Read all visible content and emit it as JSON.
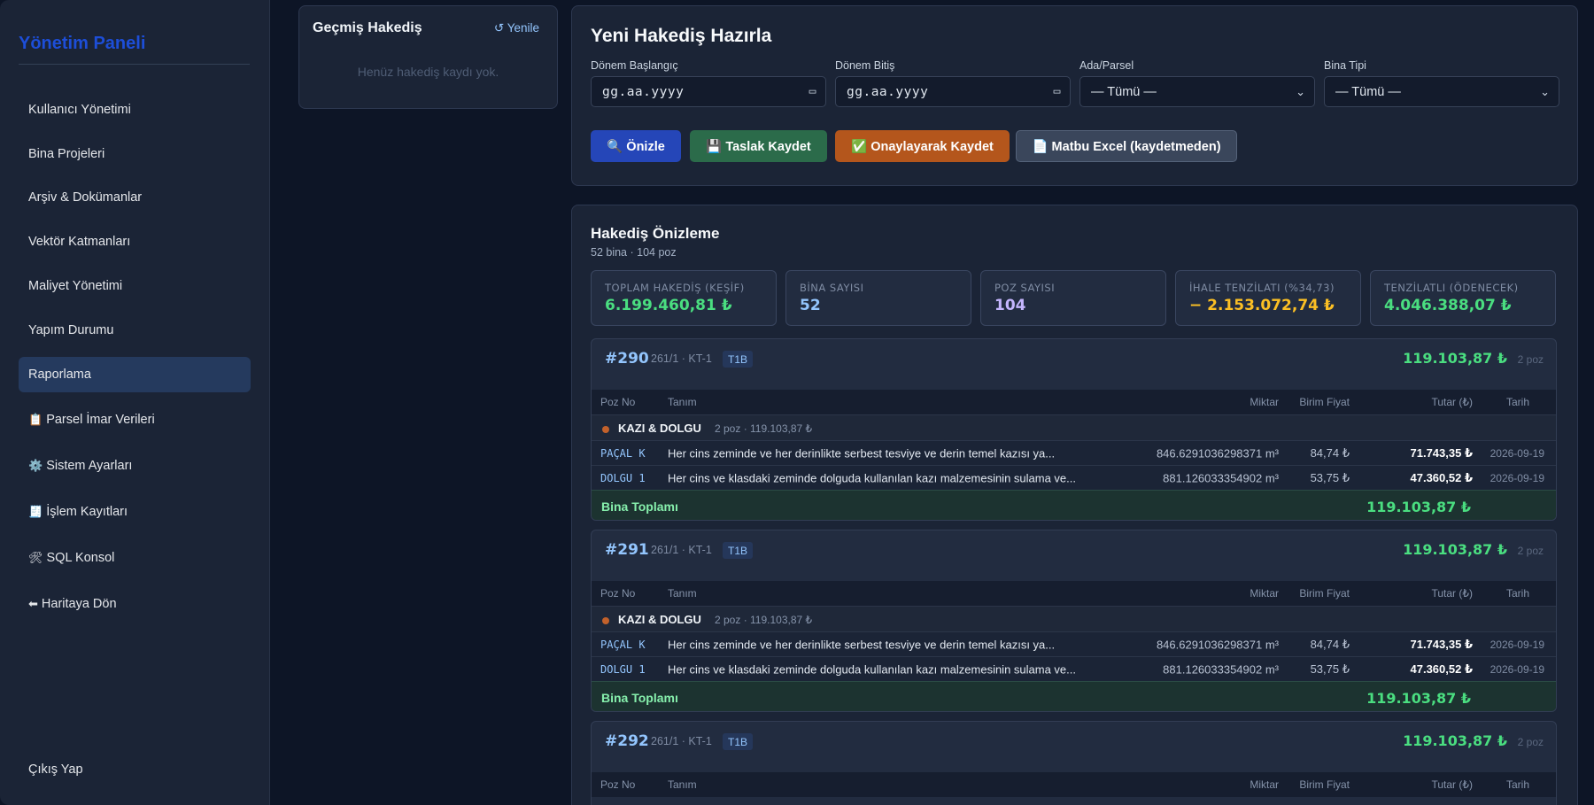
{
  "sidebar": {
    "brand": "Yönetim Paneli",
    "items": [
      {
        "label": "Kullanıcı Yönetimi",
        "icon": ""
      },
      {
        "label": "Bina Projeleri",
        "icon": ""
      },
      {
        "label": "Arşiv & Dokümanlar",
        "icon": ""
      },
      {
        "label": "Vektör Katmanları",
        "icon": ""
      },
      {
        "label": "Maliyet Yönetimi",
        "icon": ""
      },
      {
        "label": "Yapım Durumu",
        "icon": ""
      },
      {
        "label": "Raporlama",
        "icon": "",
        "active": true
      },
      {
        "label": "Parsel İmar Verileri",
        "icon": "📋"
      },
      {
        "label": "Sistem Ayarları",
        "icon": "⚙️"
      },
      {
        "label": "İşlem Kayıtları",
        "icon": "🧾"
      },
      {
        "label": "SQL Konsol",
        "icon": "🛠"
      },
      {
        "label": "Haritaya Dön",
        "icon": "⬅"
      }
    ],
    "logout": "Çıkış Yap"
  },
  "history": {
    "title": "Geçmiş Hakediş",
    "refresh": "↺ Yenile",
    "empty": "Henüz hakediş kaydı yok."
  },
  "new_hakedis": {
    "title": "Yeni Hakediş Hazırla",
    "fields": [
      {
        "label": "Dönem Başlangıç",
        "value": "gg.aa.yyyy",
        "icon": "calendar-icon"
      },
      {
        "label": "Dönem Bitiş",
        "value": "gg.aa.yyyy",
        "icon": "calendar-icon"
      },
      {
        "label": "Ada/Parsel",
        "value": "— Tümü —",
        "icon": "chevron-down-icon"
      },
      {
        "label": "Bina Tipi",
        "value": "— Tümü —",
        "icon": "chevron-down-icon"
      }
    ],
    "buttons": {
      "preview": "🔍 Önizle",
      "draft": "💾 Taslak Kaydet",
      "approve": "✅ Onaylayarak Kaydet",
      "excel": "📄 Matbu Excel (kaydetmeden)"
    }
  },
  "preview": {
    "title": "Hakediş Önizleme",
    "subtitle": "52 bina · 104 poz",
    "stats": [
      {
        "label": "TOPLAM HAKEDİŞ (KEŞİF)",
        "value": "6.199.460,81 ₺",
        "color": "#4ade80"
      },
      {
        "label": "BİNA SAYISI",
        "value": "52",
        "color": "#93c5fd"
      },
      {
        "label": "POZ SAYISI",
        "value": "104",
        "color": "#c4b5fd"
      },
      {
        "label": "İHALE TENZİLATI (%34,73)",
        "value": "− 2.153.072,74 ₺",
        "color": "#fbbf24"
      },
      {
        "label": "TENZİLATLI (ÖDENECEK)",
        "value": "4.046.388,07 ₺",
        "color": "#4ade80"
      }
    ],
    "columns": {
      "poz_no": "Poz No",
      "tanim": "Tanım",
      "miktar": "Miktar",
      "birim_fiyat": "Birim Fiyat",
      "tutar": "Tutar (₺)",
      "tarih": "Tarih"
    },
    "footer_label": "Bina Toplamı",
    "buildings": [
      {
        "id": "#290",
        "meta": "261/1 · KT-1",
        "tag": "T1B",
        "total": "119.103,87 ₺",
        "poz": "2 poz",
        "category": {
          "name": "KAZI & DOLGU",
          "meta": "2 poz · 119.103,87 ₺"
        },
        "rows": [
          {
            "code": "PAÇAL K",
            "desc": "Her cins zeminde ve her derinlikte serbest tesviye ve derin temel kazısı ya...",
            "qty": "846.6291036298371 m³",
            "price": "84,74 ₺",
            "amount": "71.743,35 ₺",
            "date": "2026-09-19"
          },
          {
            "code": "DOLGU 1",
            "desc": "Her cins ve klasdaki zeminde dolguda kullanılan kazı malzemesinin sulama ve...",
            "qty": "881.126033354902 m³",
            "price": "53,75 ₺",
            "amount": "47.360,52 ₺",
            "date": "2026-09-19"
          }
        ],
        "footer_total": "119.103,87 ₺"
      },
      {
        "id": "#291",
        "meta": "261/1 · KT-1",
        "tag": "T1B",
        "total": "119.103,87 ₺",
        "poz": "2 poz",
        "category": {
          "name": "KAZI & DOLGU",
          "meta": "2 poz · 119.103,87 ₺"
        },
        "rows": [
          {
            "code": "PAÇAL K",
            "desc": "Her cins zeminde ve her derinlikte serbest tesviye ve derin temel kazısı ya...",
            "qty": "846.6291036298371 m³",
            "price": "84,74 ₺",
            "amount": "71.743,35 ₺",
            "date": "2026-09-19"
          },
          {
            "code": "DOLGU 1",
            "desc": "Her cins ve klasdaki zeminde dolguda kullanılan kazı malzemesinin sulama ve...",
            "qty": "881.126033354902 m³",
            "price": "53,75 ₺",
            "amount": "47.360,52 ₺",
            "date": "2026-09-19"
          }
        ],
        "footer_total": "119.103,87 ₺"
      },
      {
        "id": "#292",
        "meta": "261/1 · KT-1",
        "tag": "T1B",
        "total": "119.103,87 ₺",
        "poz": "2 poz"
      }
    ]
  }
}
